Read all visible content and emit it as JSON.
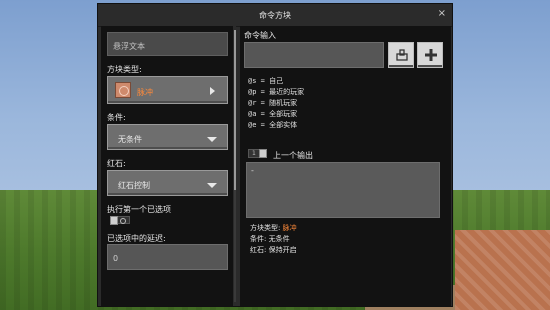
{
  "window": {
    "title": "命令方块",
    "close_glyph": "×"
  },
  "left_panel": {
    "hover_text": {
      "placeholder": "悬浮文本"
    },
    "block_type": {
      "label": "方块类型:",
      "value": "脉冲",
      "icon": "command-block-icon"
    },
    "condition": {
      "label": "条件:",
      "value": "无条件"
    },
    "redstone": {
      "label": "红石:",
      "value": "红石控制"
    },
    "execute_first": {
      "label": "执行第一个已选项"
    },
    "delay": {
      "label": "已选项中的延迟:",
      "value": "0"
    }
  },
  "right_panel": {
    "command_input_label": "命令输入",
    "selectors": [
      {
        "key": "@s",
        "desc": "自己"
      },
      {
        "key": "@p",
        "desc": "最近的玩家"
      },
      {
        "key": "@r",
        "desc": "随机玩家"
      },
      {
        "key": "@a",
        "desc": "全部玩家"
      },
      {
        "key": "@e",
        "desc": "全部实体"
      }
    ],
    "previous_output": {
      "label": "上一个输出",
      "toggle_value": "1"
    },
    "output_text": "-",
    "info": {
      "block_type_label": "方块类型:",
      "block_type_value": "脉冲",
      "condition_label": "条件:",
      "condition_value": "无条件",
      "redstone_label": "红石:",
      "redstone_value": "保持开启"
    }
  },
  "colors": {
    "accent": "#ff8a3a",
    "panel": "#121212",
    "field": "#565656"
  }
}
